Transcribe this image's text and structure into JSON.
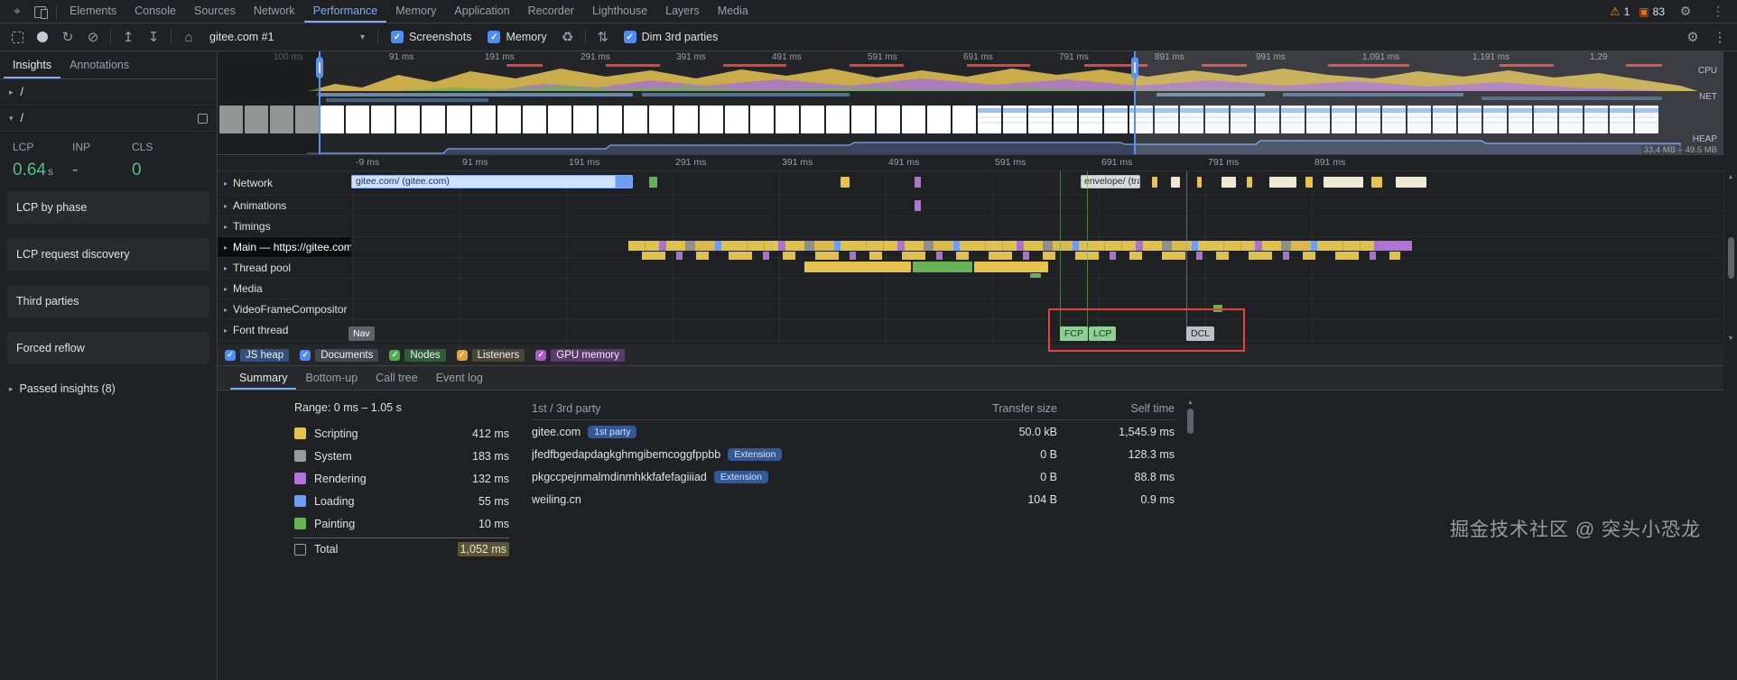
{
  "icons": {
    "inspect": "⌖",
    "warning": "⚠",
    "issues": "▣",
    "gear": "⚙",
    "kebab": "⋮",
    "reload": "↻",
    "clear": "⊘",
    "import": "↥",
    "export": "↧",
    "home": "⌂",
    "caret_down": "▾",
    "trash": "♻",
    "capture_settings": "⇅",
    "check": "✓",
    "chevron_right": "▸",
    "chevron_down": "▾",
    "arrow_up": "▲",
    "arrow_down": "▼"
  },
  "devtools": {
    "tabs": [
      "Elements",
      "Console",
      "Sources",
      "Network",
      "Performance",
      "Memory",
      "Application",
      "Recorder",
      "Lighthouse",
      "Layers",
      "Media"
    ],
    "warning_count": "1",
    "issues_count": "83"
  },
  "toolbar": {
    "history_selected": "gitee.com #1",
    "screenshots_label": "Screenshots",
    "memory_label": "Memory",
    "dim_label": "Dim 3rd parties"
  },
  "sidebar": {
    "tabs": [
      "Insights",
      "Annotations"
    ],
    "set_collapsed": "/",
    "set_expanded": "/",
    "metrics": [
      {
        "label": "LCP",
        "value": "0.64",
        "unit": "s",
        "color": "#54c081"
      },
      {
        "label": "INP",
        "value": "-",
        "unit": "",
        "color": "#9aa0a6"
      },
      {
        "label": "CLS",
        "value": "0",
        "unit": "",
        "color": "#54c081"
      }
    ],
    "cards": [
      "LCP by phase",
      "LCP request discovery",
      "Third parties",
      "Forced reflow"
    ],
    "passed": "Passed insights (8)"
  },
  "overview": {
    "time_labels": [
      "100 ms",
      "91 ms",
      "191 ms",
      "291 ms",
      "391 ms",
      "491 ms",
      "591 ms",
      "691 ms",
      "791 ms",
      "891 ms",
      "991 ms",
      "1,091 ms",
      "1,191 ms",
      "1,29"
    ],
    "cpu_label": "CPU",
    "net_label": "NET",
    "heap_label": "HEAP",
    "heap_range": "33.4 MB – 49.5 MB"
  },
  "ruler_labels": [
    "-9 ms",
    "91 ms",
    "191 ms",
    "291 ms",
    "391 ms",
    "491 ms",
    "591 ms",
    "691 ms",
    "791 ms",
    "891 ms"
  ],
  "tracks": {
    "rows": [
      "Network",
      "Animations",
      "Timings",
      "Main — https://gitee.com/",
      "Thread pool",
      "Media",
      "VideoFrameCompositor",
      "Font thread"
    ],
    "network_request": "gitee.com/ (gitee.com)",
    "envelope_request": "envelope/ (trac…",
    "nav_chip": "Nav",
    "fcp": "FCP",
    "lcp": "LCP",
    "dcl": "DCL"
  },
  "counters": [
    {
      "label": "JS heap",
      "box": "#4d8df6",
      "chip": "#30507e"
    },
    {
      "label": "Documents",
      "box": "#4d8df6",
      "chip": "#44474d"
    },
    {
      "label": "Nodes",
      "box": "#4fae53",
      "chip": "#2f5d36"
    },
    {
      "label": "Listeners",
      "box": "#e0a23c",
      "chip": "#4c4435"
    },
    {
      "label": "GPU memory",
      "box": "#a65cc5",
      "chip": "#5a3a6b"
    }
  ],
  "bottom_tabs": [
    "Summary",
    "Bottom-up",
    "Call tree",
    "Event log"
  ],
  "summary": {
    "range": "Range:  0 ms – 1.05 s",
    "legend": [
      {
        "label": "Scripting",
        "value": "412 ms",
        "color": "#e6c351"
      },
      {
        "label": "System",
        "value": "183 ms",
        "color": "#9a9a9a"
      },
      {
        "label": "Rendering",
        "value": "132 ms",
        "color": "#b173d8"
      },
      {
        "label": "Loading",
        "value": "55 ms",
        "color": "#6e9cf6"
      },
      {
        "label": "Painting",
        "value": "10 ms",
        "color": "#67b157"
      },
      {
        "label": "Total",
        "value": "1,052 ms",
        "color": "transparent"
      }
    ]
  },
  "party_table": {
    "col_name": "1st / 3rd party",
    "col_transfer": "Transfer size",
    "col_self": "Self time",
    "rows": [
      {
        "name": "gitee.com",
        "badge": "1st party",
        "transfer": "50.0 kB",
        "self": "1,545.9 ms"
      },
      {
        "name": "jfedfbgedapdagkghmgibemcoggfppbb",
        "badge": "Extension",
        "transfer": "0 B",
        "self": "128.3 ms"
      },
      {
        "name": "pkgccpejnmalmdinmhkkfafefagiiiad",
        "badge": "Extension",
        "transfer": "0 B",
        "self": "88.8 ms"
      },
      {
        "name": "weiling.cn",
        "badge": "",
        "transfer": "104 B",
        "self": "0.9 ms"
      }
    ]
  },
  "watermark": "掘金技术社区 @ 突头小恐龙"
}
